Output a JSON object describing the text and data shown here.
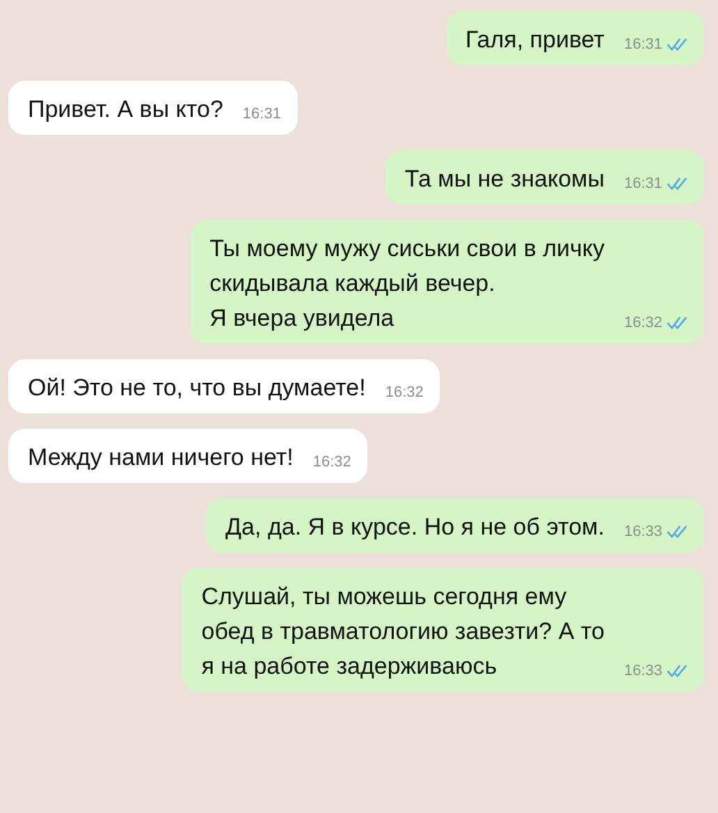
{
  "messages": [
    {
      "kind": "outgoing",
      "text": "Галя, привет",
      "time": "16:31",
      "read": true
    },
    {
      "kind": "incoming",
      "text": "Привет. А вы кто?",
      "time": "16:31"
    },
    {
      "kind": "outgoing",
      "text": "Та мы не знакомы",
      "time": "16:31",
      "read": true
    },
    {
      "kind": "outgoing",
      "text": "Ты моему мужу сиськи свои в личку\nскидывала каждый вечер.\nЯ вчера увидела",
      "time": "16:32",
      "read": true
    },
    {
      "kind": "incoming",
      "text": "Ой! Это не то, что вы думаете!",
      "time": "16:32"
    },
    {
      "kind": "incoming",
      "text": "Между нами ничего нет!",
      "time": "16:32"
    },
    {
      "kind": "outgoing",
      "text": "Да, да. Я в курсе. Но я не об этом.",
      "time": "16:33",
      "read": true
    },
    {
      "kind": "outgoing",
      "text": "Слушай, ты можешь сегодня ему\nобед в травматологию завезти? А то\nя на работе задерживаюсь",
      "time": "16:33",
      "read": true
    }
  ]
}
